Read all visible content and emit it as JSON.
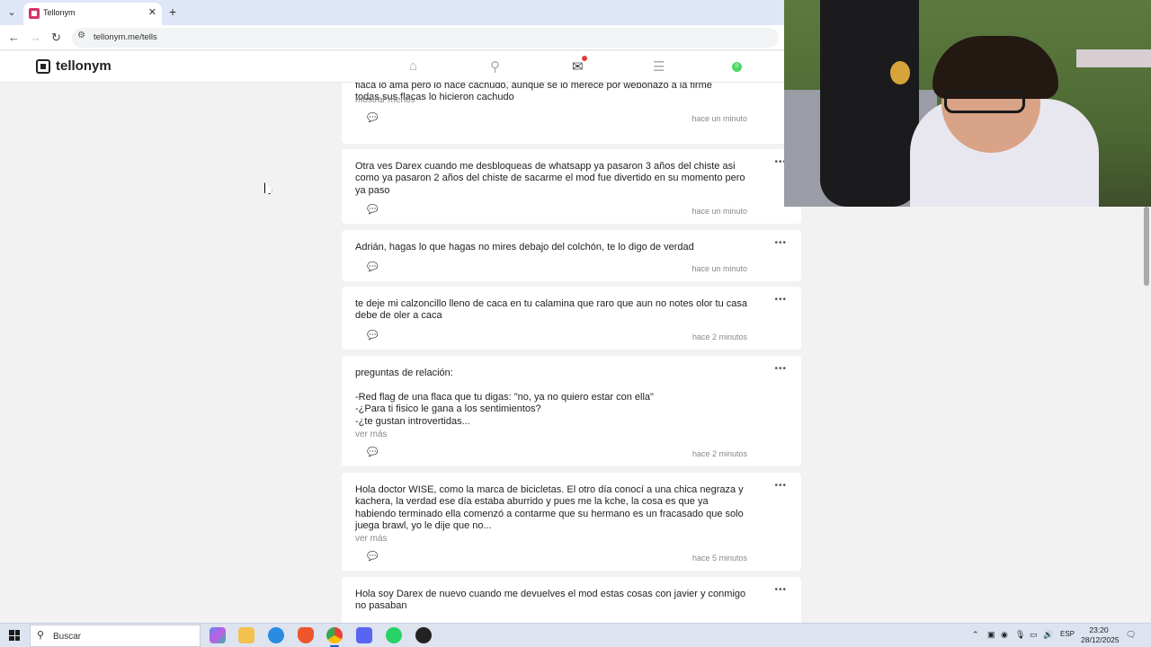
{
  "browser": {
    "tab_title": "Tellonym",
    "url": "tellonym.me/tells"
  },
  "app": {
    "logo_text": "tellonym",
    "profile_count": "0"
  },
  "tells": [
    {
      "text": "flaca lo ama pero lo hace cachudo, aunque se lo merece por webonazo a la firme\ntodas sus flacas lo hicieron cachudo",
      "more": "mostrar menos",
      "time": "hace un minuto"
    },
    {
      "text": "Otra ves Darex cuando me desbloqueas de whatsapp ya pasaron 3 años del chiste asi como ya pasaron 2 años del chiste de sacarme el mod fue divertido en su momento pero ya paso",
      "more": "",
      "time": "hace un minuto"
    },
    {
      "text": "Adrián, hagas lo que hagas no mires debajo del colchón, te lo digo de verdad",
      "more": "",
      "time": "hace un minuto"
    },
    {
      "text": "te deje mi calzoncillo lleno de caca en tu calamina que raro que aun no notes olor tu casa debe de oler a caca",
      "more": "",
      "time": "hace 2 minutos"
    },
    {
      "text": "preguntas de relación:\n\n-Red flag de una flaca que tu digas: \"no, ya no quiero estar con ella\"\n-¿Para ti fisico le gana a los sentimientos?\n-¿te gustan introvertidas...",
      "more": "ver más",
      "time": "hace 2 minutos"
    },
    {
      "text": "Hola doctor WISE, como la marca de bicicletas. El otro día conocí a una chica negraza y kachera, la verdad ese día estaba aburrido y pues me la kche, la cosa es que ya habiendo terminado ella comenzó a contarme que su hermano es un fracasado que solo juega brawl, yo le dije que no...",
      "more": "ver más",
      "time": "hace 5 minutos"
    },
    {
      "text": "Hola soy Darex de nuevo cuando me devuelves el mod estas cosas con javier y conmigo no pasaban",
      "more": "",
      "time": ""
    }
  ],
  "taskbar": {
    "search_placeholder": "Buscar",
    "language": "ESP",
    "time": "23:20",
    "date": "28/12/2025"
  },
  "icons": {
    "back": "back-arrow-icon",
    "forward": "forward-arrow-icon",
    "reload": "reload-icon",
    "home": "home-icon",
    "search": "search-icon",
    "inbox": "inbox-icon",
    "feed": "feed-icon",
    "comment": "comment-icon",
    "more": "more-dots-icon"
  },
  "colors": {
    "accent": "#d6336c",
    "notification": "#e73c3c",
    "online": "#4cd964",
    "tabbar": "#dfe6f7"
  }
}
